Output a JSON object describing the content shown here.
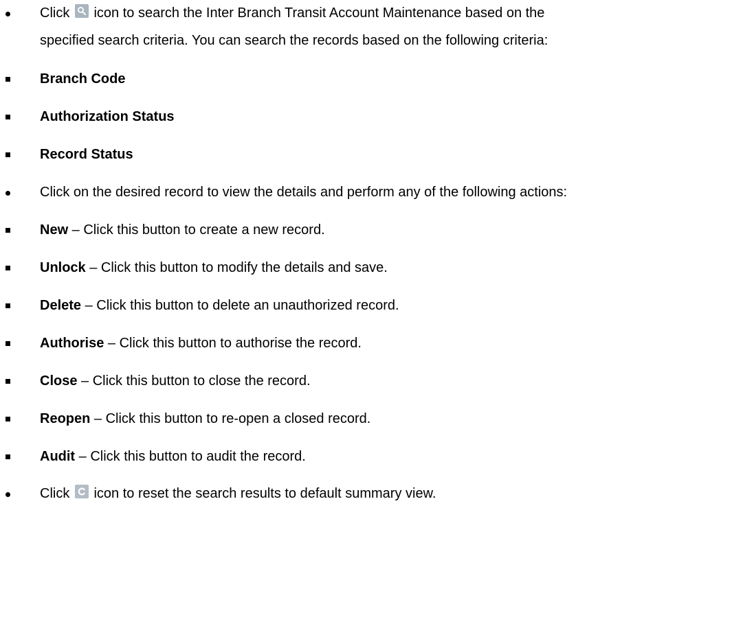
{
  "bullets": {
    "search": {
      "prefix": "Click",
      "icon": "search-icon",
      "line1_rest": "icon to search the Inter Branch Transit Account Maintenance based on the",
      "line2": "specified search criteria. You can search the records based on the following criteria:"
    },
    "criteria": [
      {
        "label": "Branch Code"
      },
      {
        "label": "Authorization Status"
      },
      {
        "label": "Record Status"
      }
    ],
    "record_click": "Click on the desired record to view the details and perform any of the following actions:",
    "actions": [
      {
        "name": "New",
        "desc": " – Click this button to create a new record."
      },
      {
        "name": "Unlock",
        "desc": " – Click this button to modify the details and save."
      },
      {
        "name": "Delete",
        "desc": " – Click this button to delete an unauthorized record."
      },
      {
        "name": "Authorise",
        "desc": " – Click this button to authorise the record."
      },
      {
        "name": "Close",
        "desc": " – Click this button to close the record."
      },
      {
        "name": "Reopen",
        "desc": " – Click this button to re-open a closed record."
      },
      {
        "name": "Audit",
        "desc": " – Click this button to audit the record."
      }
    ],
    "reset": {
      "prefix": "Click",
      "icon": "refresh-icon",
      "rest": "icon to reset the search results to default summary view."
    }
  },
  "colors": {
    "icon_bg": "#a9b5bf",
    "text": "#000000"
  }
}
